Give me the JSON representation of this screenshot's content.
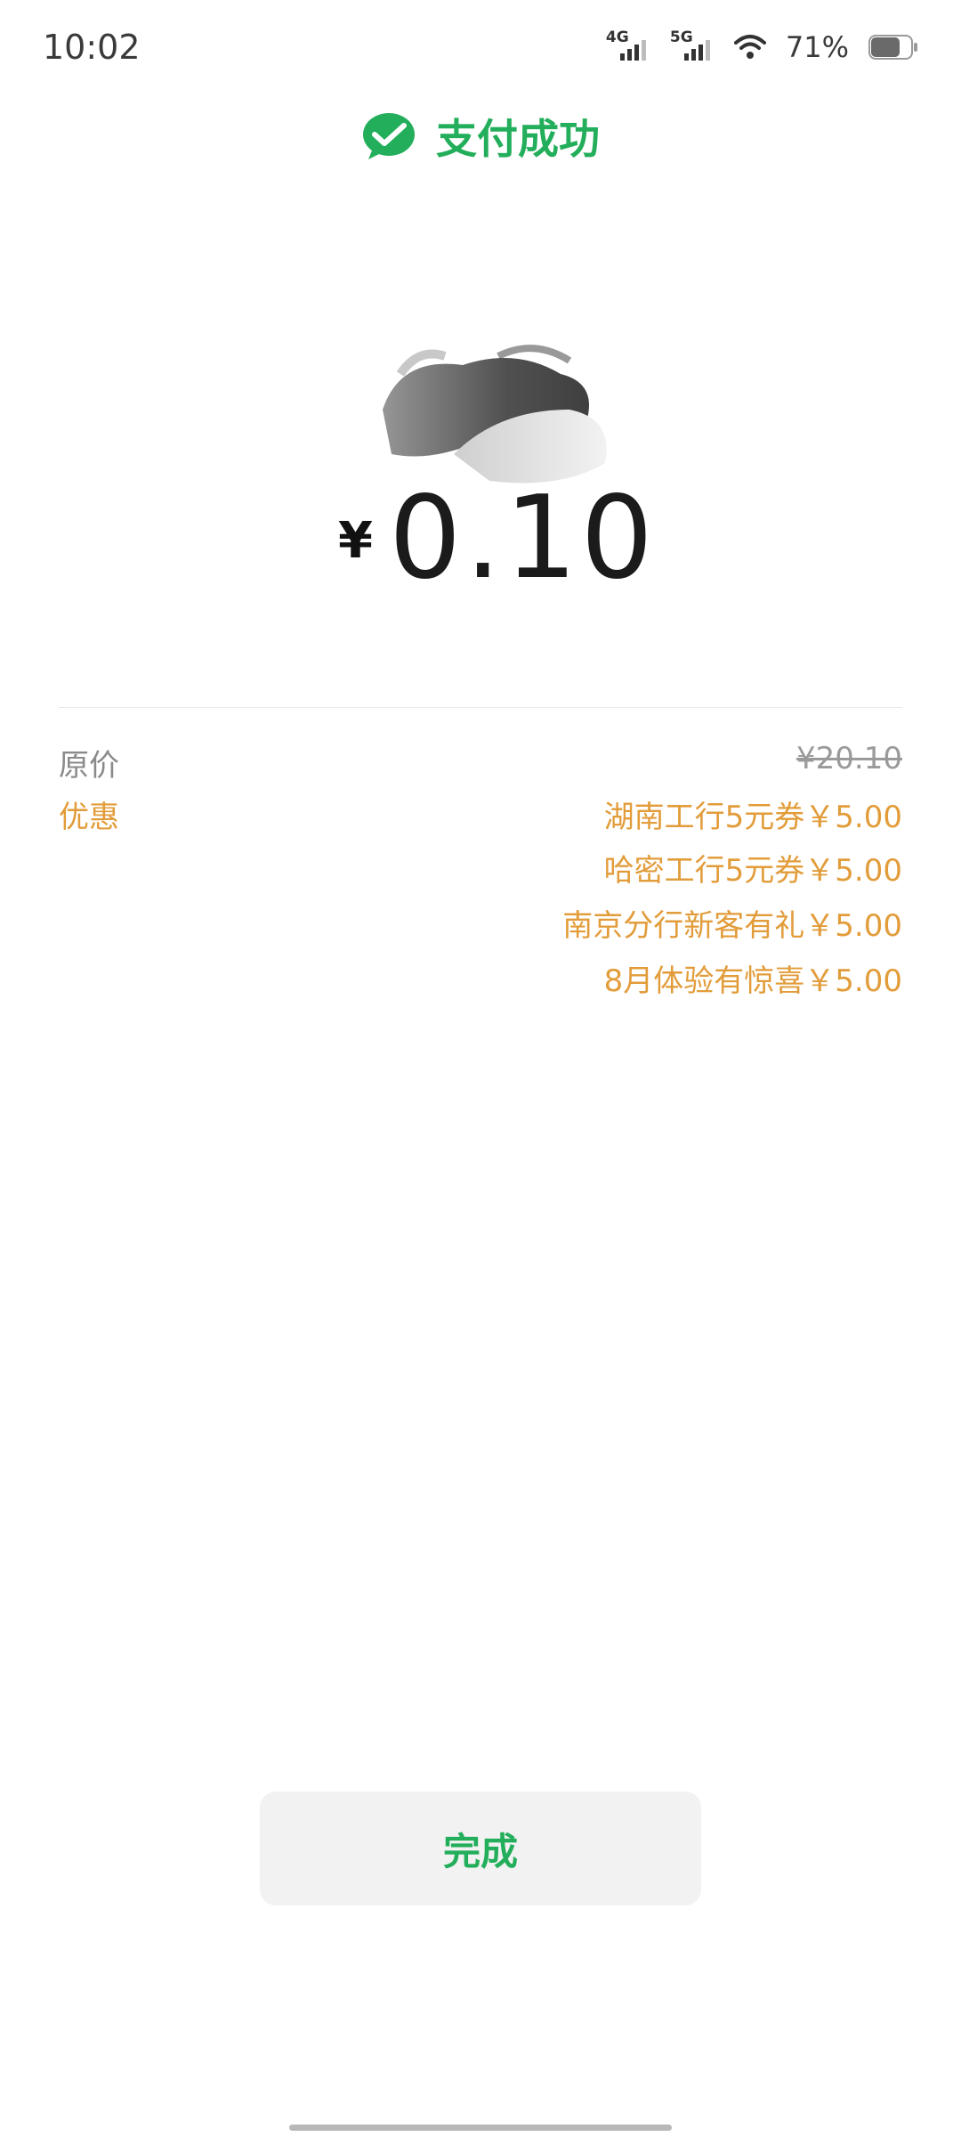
{
  "status_bar": {
    "time": "10:02",
    "network_1": "4G",
    "network_2": "5G",
    "battery": "71%",
    "icons": [
      "signal-4g-icon",
      "signal-5g-icon",
      "wifi-icon",
      "battery-icon"
    ]
  },
  "header": {
    "icon": "wechat-pay-icon",
    "title": "支付成功",
    "accent_color": "#22ae5a"
  },
  "amount": {
    "currency": "¥",
    "value": "0.10"
  },
  "details": {
    "original_label": "原价",
    "original_value": "¥20.10",
    "discount_label": "优惠",
    "discount_color": "#e29c3a",
    "discounts": [
      "湖南工行5元券￥5.00",
      "哈密工行5元券￥5.00",
      "南京分行新客有礼￥5.00",
      "8月体验有惊喜￥5.00"
    ]
  },
  "done_button": {
    "label": "完成"
  }
}
